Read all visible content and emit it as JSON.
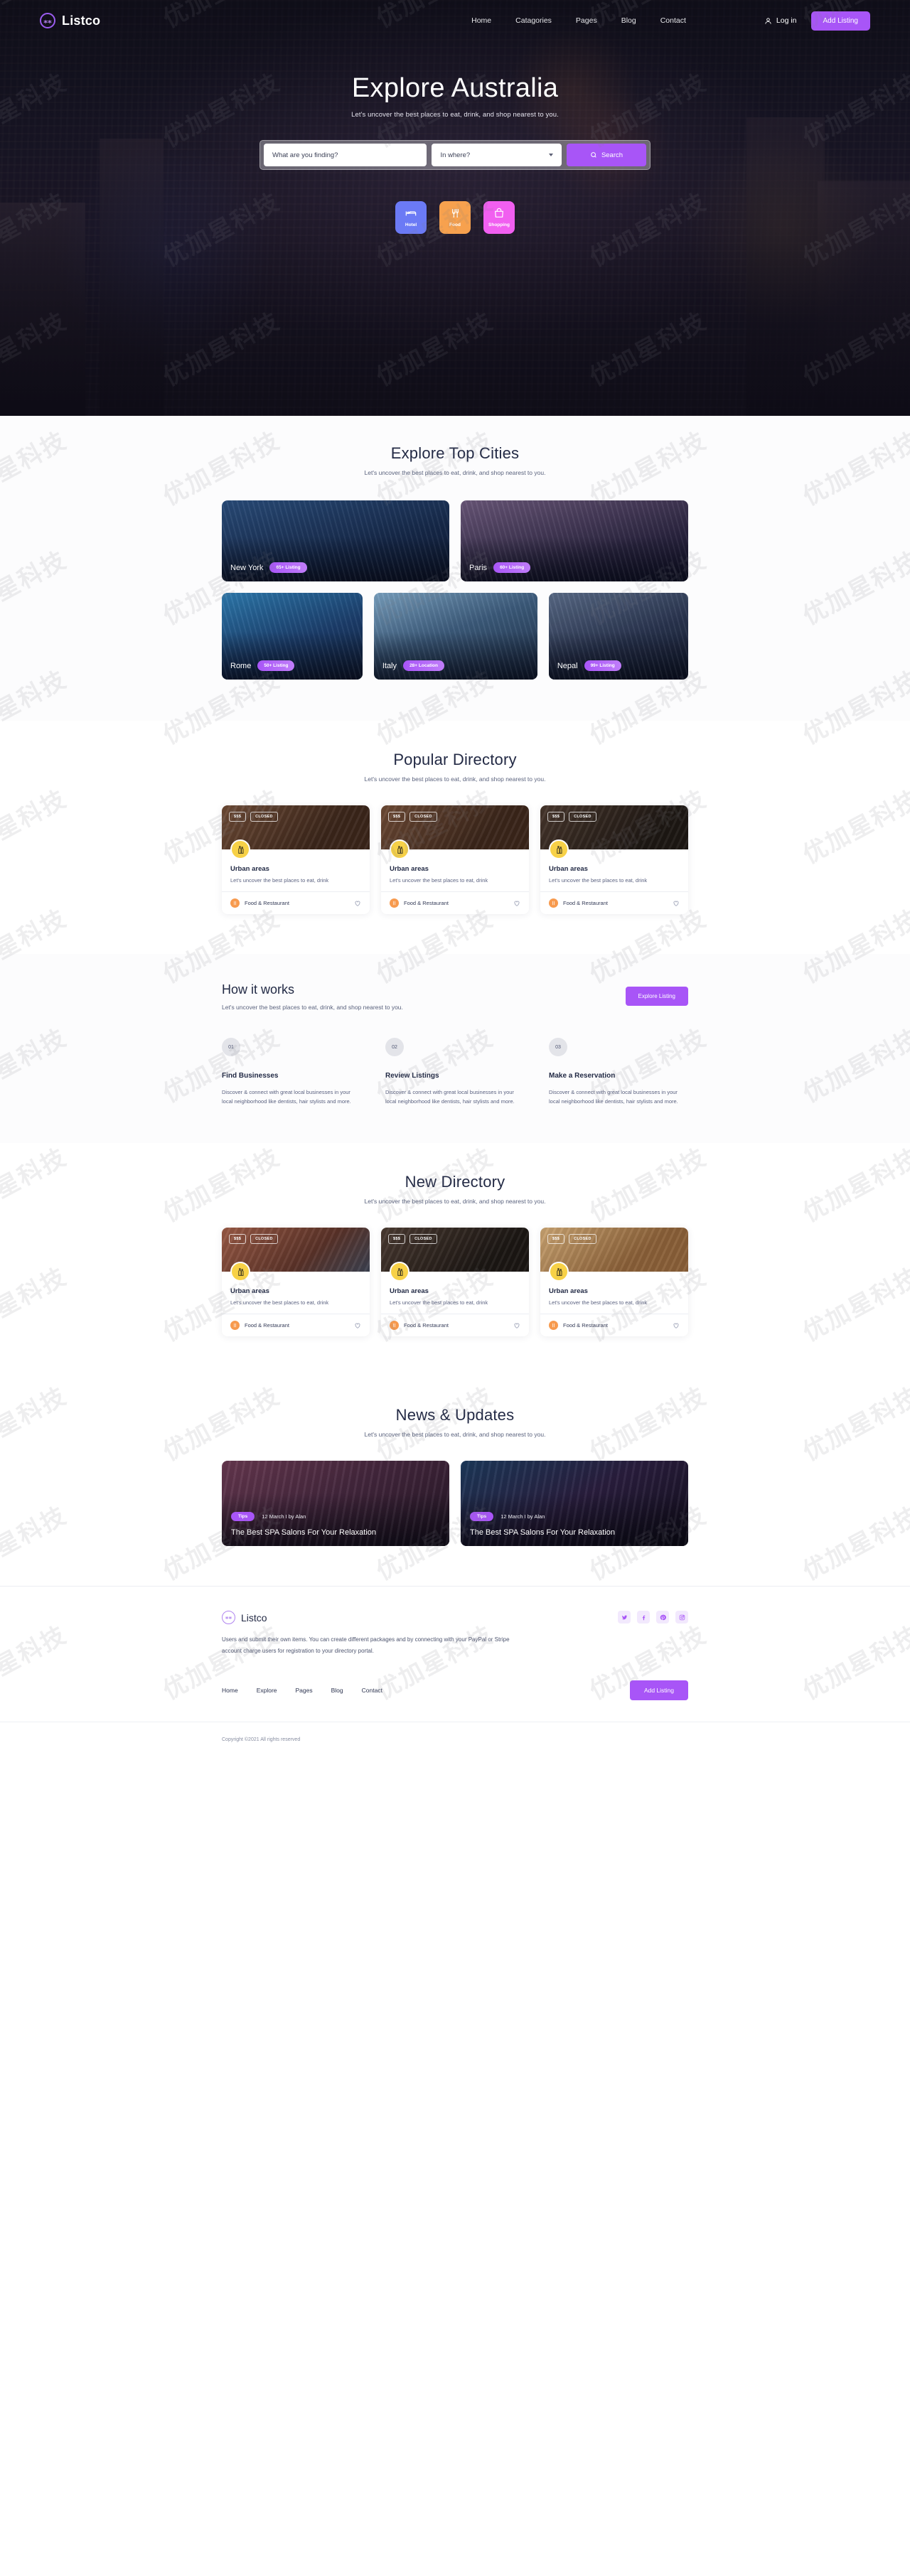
{
  "nav": {
    "brand": "Listco",
    "brand_icon": "listco-logo-icon",
    "links": [
      "Home",
      "Catagories",
      "Pages",
      "Blog",
      "Contact"
    ],
    "login_label": "Log in",
    "add_listing_label": "Add Listing"
  },
  "hero": {
    "title": "Explore Australia",
    "subtitle": "Let's uncover the best places to eat, drink, and shop nearest to you.",
    "search": {
      "what_placeholder": "What are you finding?",
      "where_placeholder": "In where?",
      "button_label": "Search",
      "button_color": "#a855f7"
    },
    "categories": [
      {
        "label": "Hotel",
        "icon": "bed-icon",
        "color": "#6b7af5"
      },
      {
        "label": "Food",
        "icon": "fork-spoon-icon",
        "color": "#f7a14e"
      },
      {
        "label": "Shopping",
        "icon": "shopping-bag-icon",
        "color": "#f15ff0"
      }
    ]
  },
  "cities": {
    "title": "Explore Top Cities",
    "subtitle": "Let's uncover the best places to eat, drink, and shop nearest to you.",
    "items": [
      {
        "name": "New York",
        "badge": "65+ Listing"
      },
      {
        "name": "Paris",
        "badge": "60+ Listing"
      },
      {
        "name": "Rome",
        "badge": "50+ Listing"
      },
      {
        "name": "Italy",
        "badge": "28+ Location"
      },
      {
        "name": "Nepal",
        "badge": "99+ Listing"
      }
    ]
  },
  "popular": {
    "title": "Popular Directory",
    "subtitle": "Let's uncover the best places to eat, drink, and shop nearest to you.",
    "cards": [
      {
        "pills": [
          "$$$",
          "CLOSED"
        ],
        "title": "Urban areas",
        "text": "Let's uncover the best places to eat, drink",
        "category": "Food & Restaurant"
      },
      {
        "pills": [
          "$$$",
          "CLOSED"
        ],
        "title": "Urban areas",
        "text": "Let's uncover the best places to eat, drink",
        "category": "Food & Restaurant"
      },
      {
        "pills": [
          "$$$",
          "CLOSED"
        ],
        "title": "Urban areas",
        "text": "Let's uncover the best places to eat, drink",
        "category": "Food & Restaurant"
      }
    ]
  },
  "how": {
    "title": "How it works",
    "subtitle": "Let's uncover the best places to eat, drink, and shop nearest to you.",
    "cta_label": "Explore Listing",
    "steps": [
      {
        "num": "01",
        "title": "Find Businesses",
        "text": "Discover & connect with great local businesses in your local neighborhood like dentists, hair stylists and more."
      },
      {
        "num": "02",
        "title": "Review Listings",
        "text": "Discover & connect with great local businesses in your local neighborhood like dentists, hair stylists and more."
      },
      {
        "num": "03",
        "title": "Make a Reservation",
        "text": "Discover & connect with great local businesses in your local neighborhood like dentists, hair stylists and more."
      }
    ]
  },
  "newdir": {
    "title": "New Directory",
    "subtitle": "Let's uncover the best places to eat, drink, and shop nearest to you.",
    "cards": [
      {
        "pills": [
          "$$$",
          "CLOSED"
        ],
        "title": "Urban areas",
        "text": "Let's uncover the best places to eat, drink",
        "category": "Food & Restaurant"
      },
      {
        "pills": [
          "$$$",
          "CLOSED"
        ],
        "title": "Urban areas",
        "text": "Let's uncover the best places to eat, drink",
        "category": "Food & Restaurant"
      },
      {
        "pills": [
          "$$$",
          "CLOSED"
        ],
        "title": "Urban areas",
        "text": "Let's uncover the best places to eat, drink",
        "category": "Food & Restaurant"
      }
    ]
  },
  "news": {
    "title": "News & Updates",
    "subtitle": "Let's uncover the best places to eat, drink, and shop nearest to you.",
    "items": [
      {
        "badge": "Tips",
        "meta": "12 March I by Alan",
        "title": "The Best SPA Salons For Your Relaxation"
      },
      {
        "badge": "Tips",
        "meta": "12 March I by Alan",
        "title": "The Best SPA Salons For Your Relaxation"
      }
    ]
  },
  "footer": {
    "brand": "Listco",
    "description": "Users and submit their own items. You can create different packages and by connecting with your PayPal or Stripe account charge users for registration to your directory portal.",
    "socials": [
      "twitter-icon",
      "facebook-icon",
      "pinterest-icon",
      "instagram-icon"
    ],
    "links": [
      "Home",
      "Explore",
      "Pages",
      "Blog",
      "Contact"
    ],
    "add_listing_label": "Add Listing",
    "copyright": "Copyright ©2021 All rights reserved"
  },
  "watermark_text": "优加星科技"
}
